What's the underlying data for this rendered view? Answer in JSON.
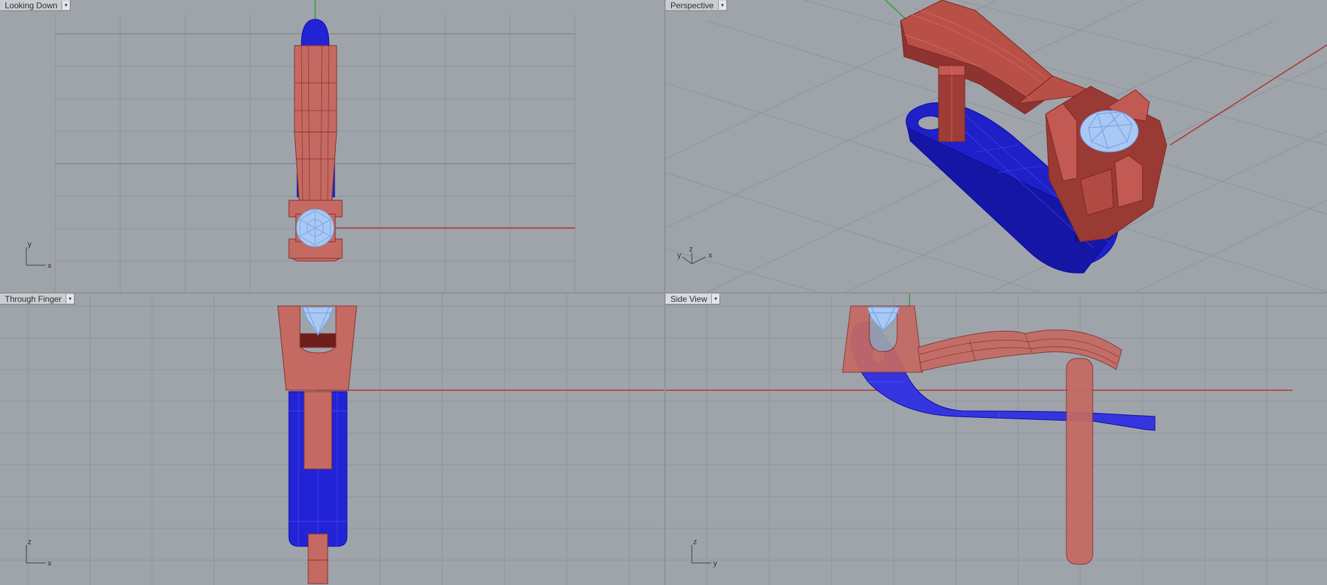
{
  "viewports": {
    "top_left": {
      "title": "Looking Down",
      "axis_h": "x",
      "axis_v": "y"
    },
    "top_right": {
      "title": "Perspective",
      "axis_labels": [
        "y",
        "z",
        "x"
      ]
    },
    "bottom_left": {
      "title": "Through Finger",
      "axis_h": "x",
      "axis_v": "z"
    },
    "bottom_right": {
      "title": "Side View",
      "axis_h": "y",
      "axis_v": "z"
    }
  },
  "menu_glyph": "▾",
  "colors": {
    "viewport_bg": "#9ea4aa",
    "grid_minor": "#8d939a",
    "grid_major": "#7a8087",
    "axis_red": "#b3312c",
    "axis_green": "#2e9b3a",
    "part_red": "#c46a63",
    "part_blue": "#2323d6",
    "gem_blue": "#8fb6ee"
  }
}
